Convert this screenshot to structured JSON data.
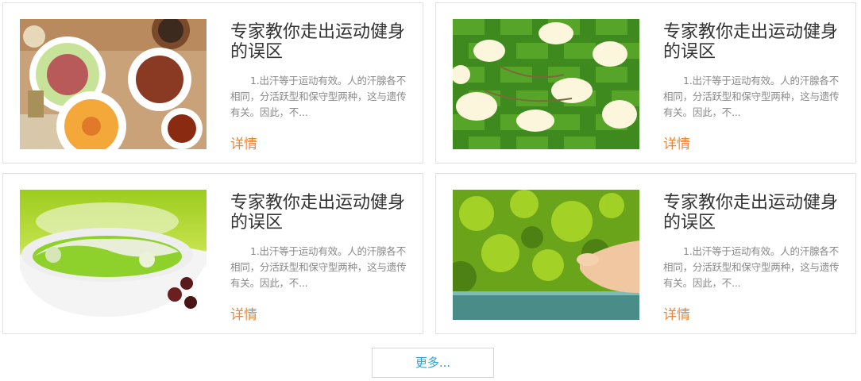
{
  "cards": [
    {
      "title": "专家教你走出运动健身的误区",
      "desc": "1.出汗等于运动有效。人的汗腺各不相同，分活跃型和保守型两种，这与遗传有关。因此，不...",
      "link": "详情",
      "image": "food-dishes-photo"
    },
    {
      "title": "专家教你走出运动健身的误区",
      "desc": "1.出汗等于运动有效。人的汗腺各不相同，分活跃型和保守型两种，这与遗传有关。因此，不...",
      "link": "详情",
      "image": "white-flowers-on-green-weave-photo"
    },
    {
      "title": "专家教你走出运动健身的误区",
      "desc": "1.出汗等于运动有效。人的汗腺各不相同，分活跃型和保守型两种，这与遗传有关。因此，不...",
      "link": "详情",
      "image": "green-porridge-bowl-photo"
    },
    {
      "title": "专家教你走出运动健身的误区",
      "desc": "1.出汗等于运动有效。人的汗腺各不相同，分活跃型和保守型两种，这与遗传有关。因此，不...",
      "link": "详情",
      "image": "meditation-hands-photo"
    }
  ],
  "more_label": "更多...",
  "colors": {
    "title": "#333333",
    "desc": "#8a8a8a",
    "link": "#e8873b",
    "more": "#2aa3dd",
    "border": "#e2e2e2"
  }
}
